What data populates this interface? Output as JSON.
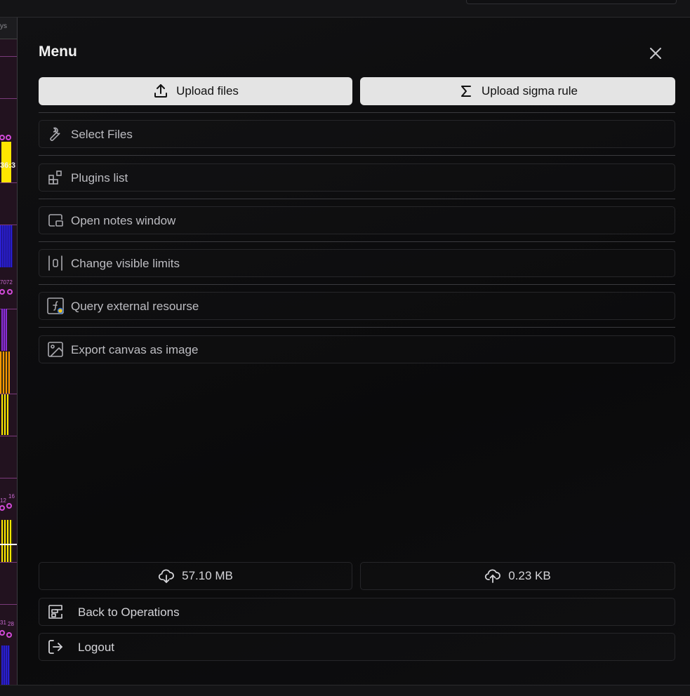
{
  "menu": {
    "title": "Menu",
    "upload_files_label": "Upload files",
    "upload_sigma_label": "Upload sigma rule",
    "items": [
      {
        "label": "Select Files",
        "icon": "wrench-icon"
      },
      {
        "label": "Plugins list",
        "icon": "plugins-icon"
      },
      {
        "label": "Open notes window",
        "icon": "picture-in-picture-icon"
      },
      {
        "label": "Change visible limits",
        "icon": "limits-icon"
      },
      {
        "label": "Query external resourse",
        "icon": "function-icon"
      },
      {
        "label": "Export canvas as image",
        "icon": "image-icon"
      }
    ],
    "download_size": "57.10 MB",
    "upload_size": "0.23 KB",
    "back_label": "Back to Operations",
    "logout_label": "Logout"
  },
  "canvas_strip": {
    "header_fragment": "ys",
    "time_fragment": "36:3",
    "counts": [
      "7072",
      "12",
      "16",
      "31",
      "28"
    ]
  },
  "colors": {
    "accent_button_bg": "#e4e4e4",
    "panel_bg": "#0b0b0c",
    "item_text": "#bdbdc2",
    "canvas_yellow": "#ffe600",
    "canvas_blue": "#2a1fd1",
    "canvas_magenta": "#d24ad8"
  }
}
